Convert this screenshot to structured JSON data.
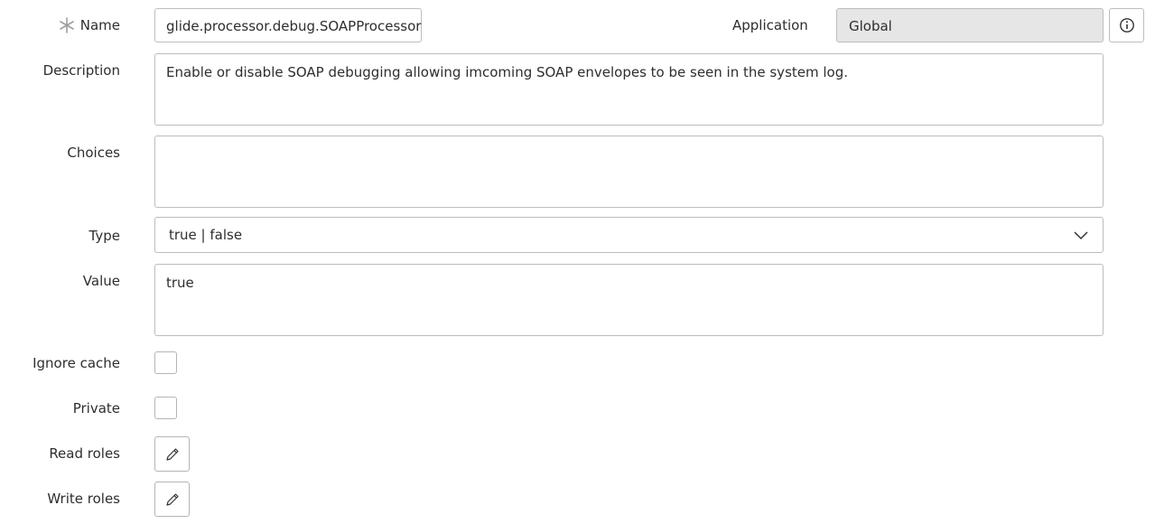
{
  "form": {
    "name": {
      "label": "Name",
      "value": "glide.processor.debug.SOAPProcessor",
      "required": true
    },
    "application": {
      "label": "Application",
      "value": "Global",
      "info_icon": "info-icon"
    },
    "description": {
      "label": "Description",
      "value": "Enable or disable SOAP debugging allowing imcoming SOAP envelopes to be seen in the system log."
    },
    "choices": {
      "label": "Choices",
      "value": ""
    },
    "type": {
      "label": "Type",
      "value": "true | false",
      "icon": "chevron-down-icon"
    },
    "value": {
      "label": "Value",
      "value": "true"
    },
    "ignore_cache": {
      "label": "Ignore cache",
      "checked": false
    },
    "private": {
      "label": "Private",
      "checked": false
    },
    "read_roles": {
      "label": "Read roles",
      "icon": "pencil-icon"
    },
    "write_roles": {
      "label": "Write roles",
      "icon": "pencil-icon"
    }
  },
  "colors": {
    "border": "#bdbdbd",
    "readonly_bg": "#e6e6e6",
    "text": "#2e2e2e",
    "required_star": "#9e9e9e"
  }
}
